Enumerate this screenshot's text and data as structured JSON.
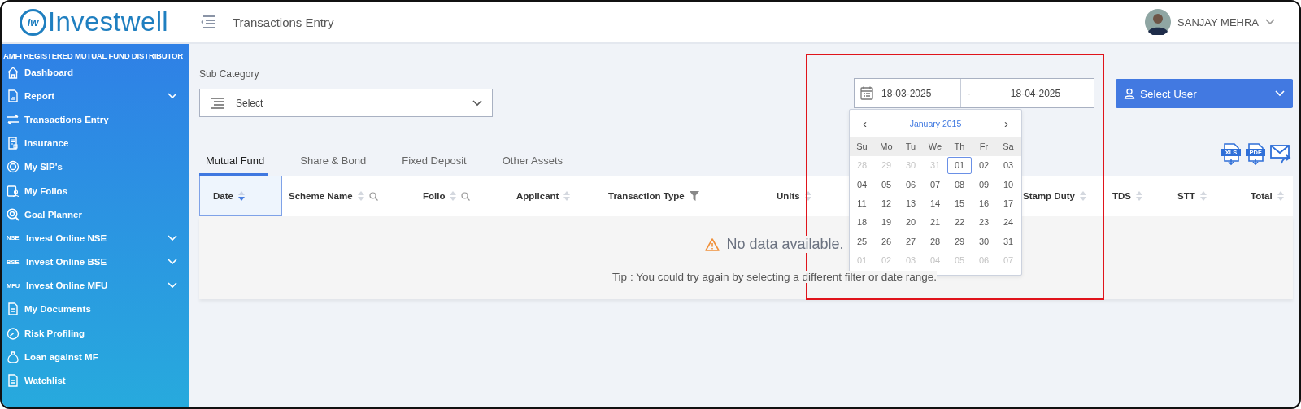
{
  "header": {
    "logo_mark": "iw",
    "logo_text": "Investwell",
    "page_title": "Transactions Entry",
    "user_name": "SANJAY MEHRA"
  },
  "sidebar": {
    "heading": "AMFI REGISTERED MUTUAL FUND DISTRIBUTOR",
    "items": [
      {
        "label": "Dashboard",
        "expandable": false
      },
      {
        "label": "Report",
        "expandable": true
      },
      {
        "label": "Transactions Entry",
        "expandable": false
      },
      {
        "label": "Insurance",
        "expandable": false
      },
      {
        "label": "My SIP's",
        "expandable": false
      },
      {
        "label": "My Folios",
        "expandable": false
      },
      {
        "label": "Goal Planner",
        "expandable": false
      },
      {
        "label": "Invest Online NSE",
        "badge": "NSE",
        "expandable": true
      },
      {
        "label": "Invest Online BSE",
        "badge": "BSE",
        "expandable": true
      },
      {
        "label": "Invest Online MFU",
        "badge": "MFU",
        "expandable": true
      },
      {
        "label": "My Documents",
        "expandable": false
      },
      {
        "label": "Risk Profiling",
        "expandable": false
      },
      {
        "label": "Loan against MF",
        "expandable": false
      },
      {
        "label": "Watchlist",
        "expandable": false
      }
    ]
  },
  "filters": {
    "sub_category_label": "Sub Category",
    "sub_category_placeholder": "Select",
    "date_from": "18-03-2025",
    "date_separator": "-",
    "date_to": "18-04-2025",
    "select_user": "Select User"
  },
  "tabs": [
    {
      "label": "Mutual Fund",
      "selected": true
    },
    {
      "label": "Share & Bond",
      "selected": false
    },
    {
      "label": "Fixed Deposit",
      "selected": false
    },
    {
      "label": "Other Assets",
      "selected": false
    }
  ],
  "exports": [
    {
      "label": "XLS"
    },
    {
      "label": "PDF"
    }
  ],
  "table": {
    "columns": [
      {
        "label": "Date",
        "sortable": true,
        "searchable": false,
        "filterable": false,
        "selected": true
      },
      {
        "label": "Scheme Name",
        "sortable": true,
        "searchable": true,
        "filterable": false,
        "selected": false
      },
      {
        "label": "Folio",
        "sortable": true,
        "searchable": true,
        "filterable": false,
        "selected": false
      },
      {
        "label": "Applicant",
        "sortable": true,
        "searchable": false,
        "filterable": false,
        "selected": false
      },
      {
        "label": "Transaction Type",
        "sortable": false,
        "searchable": false,
        "filterable": true,
        "selected": false
      },
      {
        "label": "Units",
        "sortable": true,
        "searchable": false,
        "filterable": false,
        "selected": false
      },
      {
        "label": "Stamp Duty",
        "sortable": true,
        "searchable": false,
        "filterable": false,
        "selected": false
      },
      {
        "label": "TDS",
        "sortable": true,
        "searchable": false,
        "filterable": false,
        "selected": false
      },
      {
        "label": "STT",
        "sortable": true,
        "searchable": false,
        "filterable": false,
        "selected": false
      },
      {
        "label": "Total",
        "sortable": true,
        "searchable": false,
        "filterable": false,
        "selected": false
      }
    ],
    "empty_title": "No data available.",
    "empty_tip": "Tip : You could try again by selecting a different filter or date range."
  },
  "calendar": {
    "prev": "‹",
    "month": "January 2015",
    "next": "›",
    "weekdays": [
      "Su",
      "Mo",
      "Tu",
      "We",
      "Th",
      "Fr",
      "Sa"
    ],
    "weeks": [
      [
        {
          "day": "28",
          "outside": true,
          "selected": false
        },
        {
          "day": "29",
          "outside": true,
          "selected": false
        },
        {
          "day": "30",
          "outside": true,
          "selected": false
        },
        {
          "day": "31",
          "outside": true,
          "selected": false
        },
        {
          "day": "01",
          "outside": false,
          "selected": true
        },
        {
          "day": "02",
          "outside": false,
          "selected": false
        },
        {
          "day": "03",
          "outside": false,
          "selected": false
        }
      ],
      [
        {
          "day": "04",
          "outside": false,
          "selected": false
        },
        {
          "day": "05",
          "outside": false,
          "selected": false
        },
        {
          "day": "06",
          "outside": false,
          "selected": false
        },
        {
          "day": "07",
          "outside": false,
          "selected": false
        },
        {
          "day": "08",
          "outside": false,
          "selected": false
        },
        {
          "day": "09",
          "outside": false,
          "selected": false
        },
        {
          "day": "10",
          "outside": false,
          "selected": false
        }
      ],
      [
        {
          "day": "11",
          "outside": false,
          "selected": false
        },
        {
          "day": "12",
          "outside": false,
          "selected": false
        },
        {
          "day": "13",
          "outside": false,
          "selected": false
        },
        {
          "day": "14",
          "outside": false,
          "selected": false
        },
        {
          "day": "15",
          "outside": false,
          "selected": false
        },
        {
          "day": "16",
          "outside": false,
          "selected": false
        },
        {
          "day": "17",
          "outside": false,
          "selected": false
        }
      ],
      [
        {
          "day": "18",
          "outside": false,
          "selected": false
        },
        {
          "day": "19",
          "outside": false,
          "selected": false
        },
        {
          "day": "20",
          "outside": false,
          "selected": false
        },
        {
          "day": "21",
          "outside": false,
          "selected": false
        },
        {
          "day": "22",
          "outside": false,
          "selected": false
        },
        {
          "day": "23",
          "outside": false,
          "selected": false
        },
        {
          "day": "24",
          "outside": false,
          "selected": false
        }
      ],
      [
        {
          "day": "25",
          "outside": false,
          "selected": false
        },
        {
          "day": "26",
          "outside": false,
          "selected": false
        },
        {
          "day": "27",
          "outside": false,
          "selected": false
        },
        {
          "day": "28",
          "outside": false,
          "selected": false
        },
        {
          "day": "29",
          "outside": false,
          "selected": false
        },
        {
          "day": "30",
          "outside": false,
          "selected": false
        },
        {
          "day": "31",
          "outside": false,
          "selected": false
        }
      ],
      [
        {
          "day": "01",
          "outside": true,
          "selected": false
        },
        {
          "day": "02",
          "outside": true,
          "selected": false
        },
        {
          "day": "03",
          "outside": true,
          "selected": false
        },
        {
          "day": "04",
          "outside": true,
          "selected": false
        },
        {
          "day": "05",
          "outside": true,
          "selected": false
        },
        {
          "day": "06",
          "outside": true,
          "selected": false
        },
        {
          "day": "07",
          "outside": true,
          "selected": false
        }
      ]
    ]
  }
}
